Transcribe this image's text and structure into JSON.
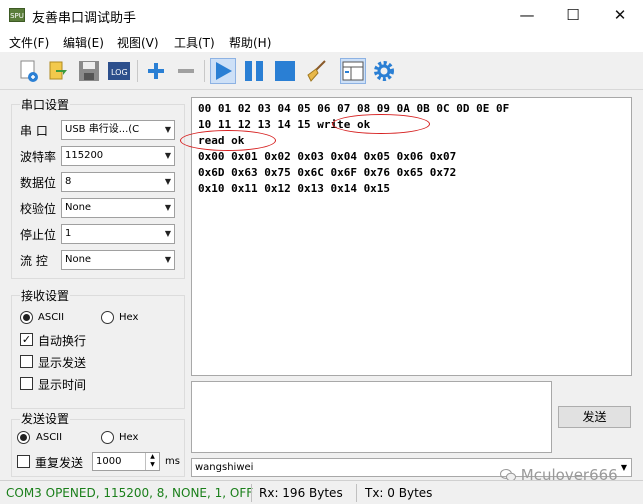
{
  "window": {
    "title": "友善串口调试助手",
    "minimize": "—",
    "maximize": "☐",
    "close": "✕"
  },
  "menu": [
    "文件(F)",
    "编辑(E)",
    "视图(V)",
    "工具(T)",
    "帮助(H)"
  ],
  "toolbar": [
    "new-icon",
    "open-icon",
    "save-icon",
    "log-icon",
    "add-icon",
    "remove-icon",
    "play-icon",
    "pause-icon",
    "stop-icon",
    "broom-icon",
    "layout-icon",
    "gear-icon"
  ],
  "serial": {
    "title": "串口设置",
    "port_label": "串  口",
    "port_value": "USB 串行设...(C",
    "baud_label": "波特率",
    "baud_value": "115200",
    "databits_label": "数据位",
    "databits_value": "8",
    "parity_label": "校验位",
    "parity_value": "None",
    "stopbits_label": "停止位",
    "stopbits_value": "1",
    "flow_label": "流  控",
    "flow_value": "None"
  },
  "receive": {
    "title": "接收设置",
    "ascii": "ASCII",
    "hex": "Hex",
    "ascii_selected": true,
    "auto_newline": "自动换行",
    "auto_newline_checked": true,
    "show_send": "显示发送",
    "show_send_checked": false,
    "show_time": "显示时间",
    "show_time_checked": false
  },
  "send_settings": {
    "title": "发送设置",
    "ascii": "ASCII",
    "hex": "Hex",
    "ascii_selected": true,
    "repeat": "重复发送",
    "repeat_checked": false,
    "interval": "1000",
    "unit": "ms"
  },
  "receive_text": "00 01 02 03 04 05 06 07 08 09 0A 0B 0C 0D 0E 0F\n10 11 12 13 14 15 write ok\nread ok\n0x00 0x01 0x02 0x03 0x04 0x05 0x06 0x07\n0x6D 0x63 0x75 0x6C 0x6F 0x76 0x65 0x72\n0x10 0x11 0x12 0x13 0x14 0x15",
  "send_button": "发送",
  "history_value": "wangshiwei",
  "watermark": "Mculover666",
  "status": {
    "port": "COM3 OPENED, 115200, 8, NONE, 1, OFF",
    "rx": "Rx: 196 Bytes",
    "tx": "Tx: 0 Bytes"
  },
  "colors": {
    "status_green": "#1a7f1a",
    "annotation_red": "#d62020",
    "accent_blue": "#2a7fd4"
  }
}
